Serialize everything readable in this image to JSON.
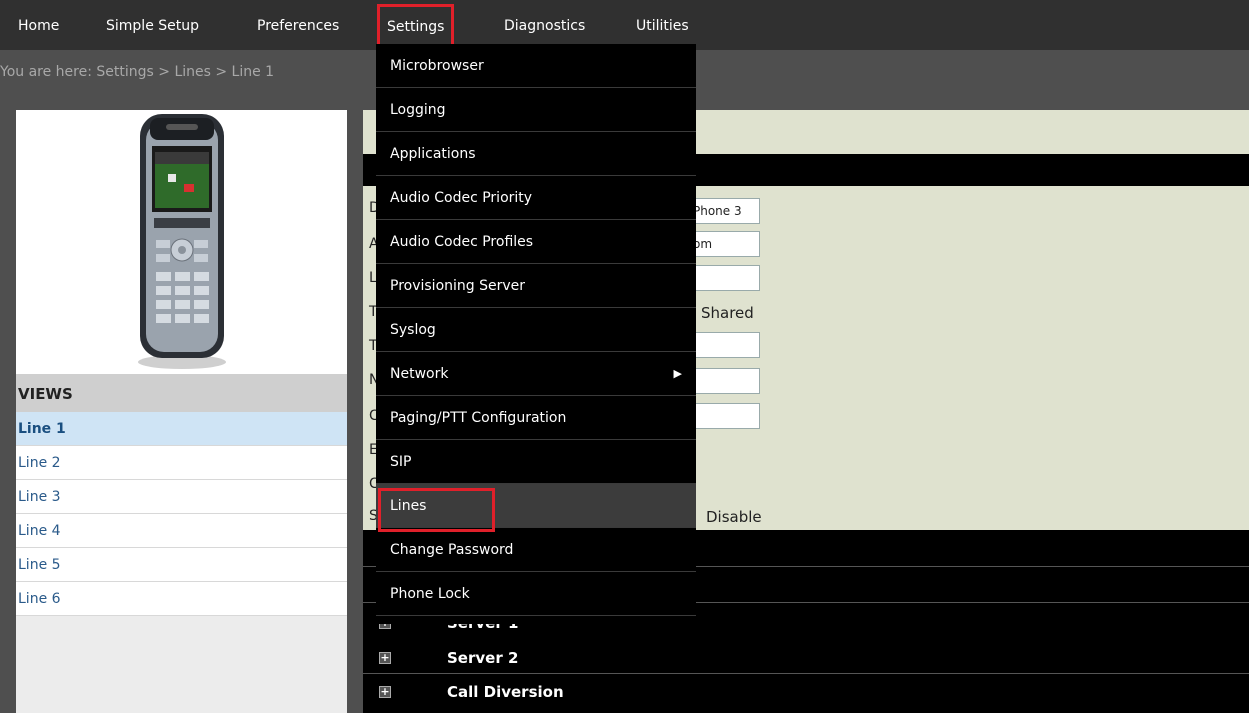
{
  "nav": {
    "items": [
      "Home",
      "Simple Setup",
      "Preferences",
      "Settings",
      "Diagnostics",
      "Utilities"
    ],
    "active": "Settings"
  },
  "breadcrumb": "You are here: Settings > Lines > Line 1",
  "views": {
    "heading": "VIEWS",
    "items": [
      "Line 1",
      "Line 2",
      "Line 3",
      "Line 4",
      "Line 5",
      "Line 6"
    ],
    "selected": "Line 1"
  },
  "menu": {
    "items": [
      "Microbrowser",
      "Logging",
      "Applications",
      "Audio Codec Priority",
      "Audio Codec Profiles",
      "Provisioning Server",
      "Syslog",
      "Network",
      "Paging/PTT Configuration",
      "SIP",
      "Lines",
      "Change Password",
      "Phone Lock"
    ],
    "highlighted": "Lines"
  },
  "form": {
    "field1_value": "Phone 3",
    "field2_value": "om",
    "shared_label": "Shared",
    "disable_label": "Disable",
    "peek_letters": [
      "D",
      "A",
      "L",
      "T",
      "T",
      "N",
      "C",
      "E",
      "C",
      "S"
    ]
  },
  "sections": {
    "server1": "Server 1",
    "server2": "Server 2",
    "call_diversion": "Call Diversion"
  },
  "colors": {
    "nav_bg": "#303030",
    "active_outline": "#e0202a",
    "content_bg": "#dfe2cf",
    "selected_row": "#cfe4f5"
  }
}
